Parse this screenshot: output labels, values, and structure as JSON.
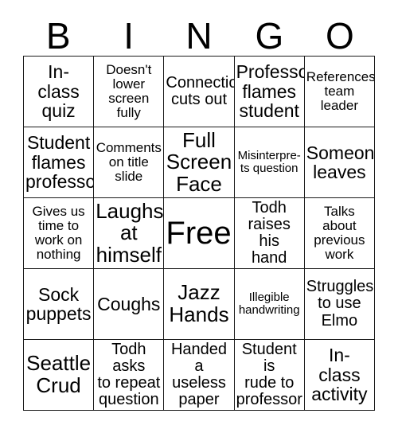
{
  "card": {
    "title": "BINGO",
    "headers": [
      "B",
      "I",
      "N",
      "G",
      "O"
    ],
    "free_space_label": "Free!",
    "colors": {
      "background": "#ffffff",
      "border": "#1a1a1a",
      "text": "#000000"
    },
    "rows": [
      [
        {
          "text": "In-\nclass\nquiz",
          "size": "ml"
        },
        {
          "text": "Doesn't\nlower\nscreen\nfully",
          "size": "sm"
        },
        {
          "text": "Connection\ncuts out",
          "size": "md"
        },
        {
          "text": "Professor\nflames\nstudent",
          "size": "ml"
        },
        {
          "text": "References\nteam\nleader",
          "size": "sm"
        }
      ],
      [
        {
          "text": "Student\nflames\nprofessor",
          "size": "ml"
        },
        {
          "text": "Comments\non title\nslide",
          "size": "sm"
        },
        {
          "text": "Full\nScreen\nFace",
          "size": "lg"
        },
        {
          "text": "Misinterpre-\nts question",
          "size": "xs"
        },
        {
          "text": "Someone\nleaves",
          "size": "ml"
        }
      ],
      [
        {
          "text": "Gives us\ntime to\nwork on\nnothing",
          "size": "sm"
        },
        {
          "text": "Laughs\nat\nhimself",
          "size": "lg"
        },
        {
          "text": "Free!",
          "size": "xl"
        },
        {
          "text": "Todh\nraises his\nhand",
          "size": "md"
        },
        {
          "text": "Talks\nabout\nprevious\nwork",
          "size": "sm"
        }
      ],
      [
        {
          "text": "Sock\npuppets",
          "size": "ml"
        },
        {
          "text": "Coughs",
          "size": "ml"
        },
        {
          "text": "Jazz\nHands",
          "size": "lg"
        },
        {
          "text": "Illegible\nhandwriting",
          "size": "xs"
        },
        {
          "text": "Struggles\nto use\nElmo",
          "size": "md"
        }
      ],
      [
        {
          "text": "Seattle\nCrud",
          "size": "lg"
        },
        {
          "text": "Todh asks\nto repeat\nquestion",
          "size": "md"
        },
        {
          "text": "Handed a\nuseless\npaper",
          "size": "md"
        },
        {
          "text": "Student is\nrude to\nprofessor",
          "size": "md"
        },
        {
          "text": "In-\nclass\nactivity",
          "size": "ml"
        }
      ]
    ]
  }
}
